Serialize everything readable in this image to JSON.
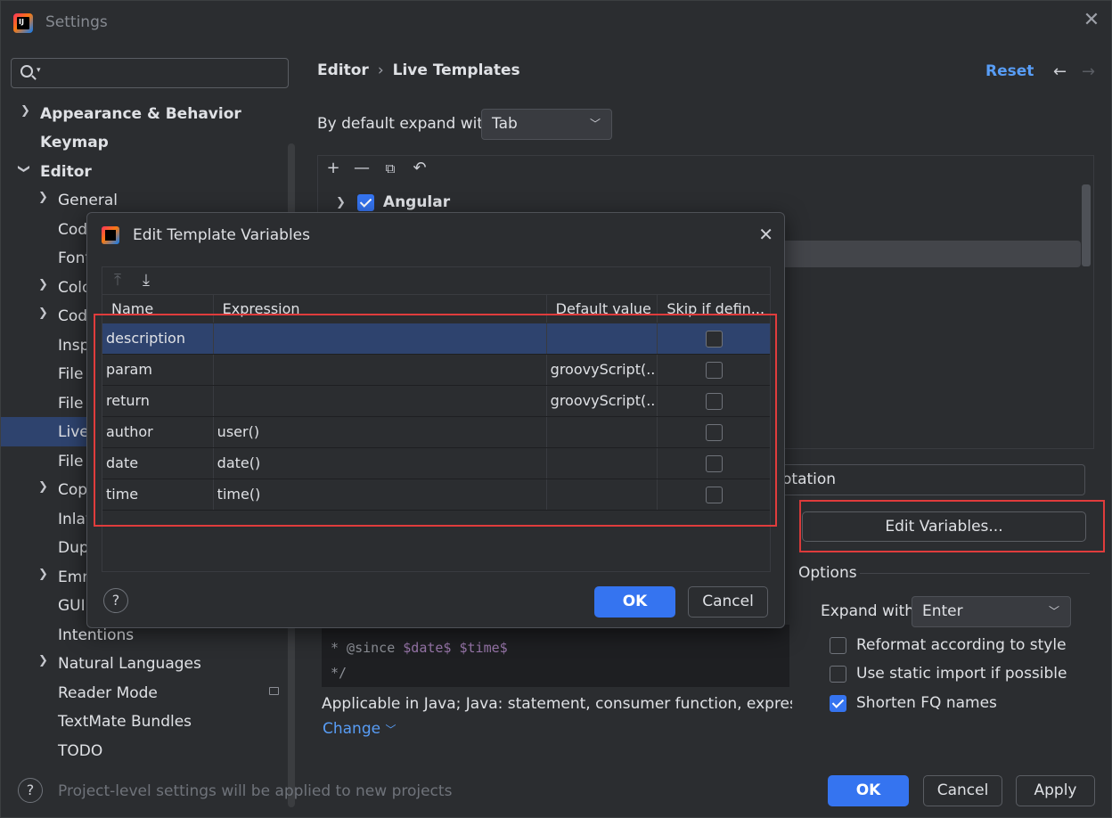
{
  "window": {
    "title": "Settings",
    "logo_text": "IJ"
  },
  "sidebar": {
    "search_placeholder": "",
    "items": [
      {
        "label": "Appearance & Behavior"
      },
      {
        "label": "Keymap"
      },
      {
        "label": "Editor"
      },
      {
        "label": "General"
      },
      {
        "label": "Code"
      },
      {
        "label": "Font"
      },
      {
        "label": "Colo"
      },
      {
        "label": "Code"
      },
      {
        "label": "Insp"
      },
      {
        "label": "File"
      },
      {
        "label": "File"
      },
      {
        "label": "Live"
      },
      {
        "label": "File"
      },
      {
        "label": "Copy"
      },
      {
        "label": "Inlay"
      },
      {
        "label": "Dup"
      },
      {
        "label": "Emm"
      },
      {
        "label": "GUI"
      },
      {
        "label": "Intentions"
      },
      {
        "label": "Natural Languages"
      },
      {
        "label": "Reader Mode"
      },
      {
        "label": "TextMate Bundles"
      },
      {
        "label": "TODO"
      }
    ]
  },
  "header": {
    "breadcrumb": [
      "Editor",
      "Live Templates"
    ],
    "separator": "›",
    "reset": "Reset"
  },
  "expand": {
    "label": "By default expand with",
    "value": "Tab"
  },
  "templates": {
    "group": "Angular",
    "group_checked": true
  },
  "description_field": {
    "value": "otation"
  },
  "edit_variables_button": "Edit Variables...",
  "options": {
    "title": "Options",
    "expand_with_label": "Expand with",
    "expand_with_value": "Enter",
    "checkboxes": [
      {
        "label": "Reformat according to style",
        "checked": false
      },
      {
        "label": "Use static import if possible",
        "checked": false
      },
      {
        "label": "Shorten FQ names",
        "checked": true
      }
    ]
  },
  "code": {
    "line1_prefix": "* @since ",
    "line1_var1": "$date$",
    "line1_var2": "$time$",
    "line2": "*/"
  },
  "applicable": {
    "text": "Applicable in Java; Java: statement, consumer function, expression, '..",
    "change": "Change"
  },
  "bottom": {
    "note": "Project-level settings will be applied to new projects",
    "ok": "OK",
    "cancel": "Cancel",
    "apply": "Apply"
  },
  "dialog": {
    "title": "Edit Template Variables",
    "columns": [
      "Name",
      "Expression",
      "Default value",
      "Skip if defin..."
    ],
    "rows": [
      {
        "name": "description",
        "expression": "",
        "default": "",
        "skip": false
      },
      {
        "name": "param",
        "expression": "",
        "default": "groovyScript(...",
        "skip": false
      },
      {
        "name": "return",
        "expression": "",
        "default": "groovyScript(...",
        "skip": false
      },
      {
        "name": "author",
        "expression": "user()",
        "default": "",
        "skip": false
      },
      {
        "name": "date",
        "expression": "date()",
        "default": "",
        "skip": false
      },
      {
        "name": "time",
        "expression": "time()",
        "default": "",
        "skip": false
      }
    ],
    "ok": "OK",
    "cancel": "Cancel"
  },
  "colors": {
    "accent": "#3574f0",
    "link": "#589df6",
    "highlight_box": "#e03c3c",
    "selection": "#2e436e",
    "background": "#2b2d30"
  }
}
